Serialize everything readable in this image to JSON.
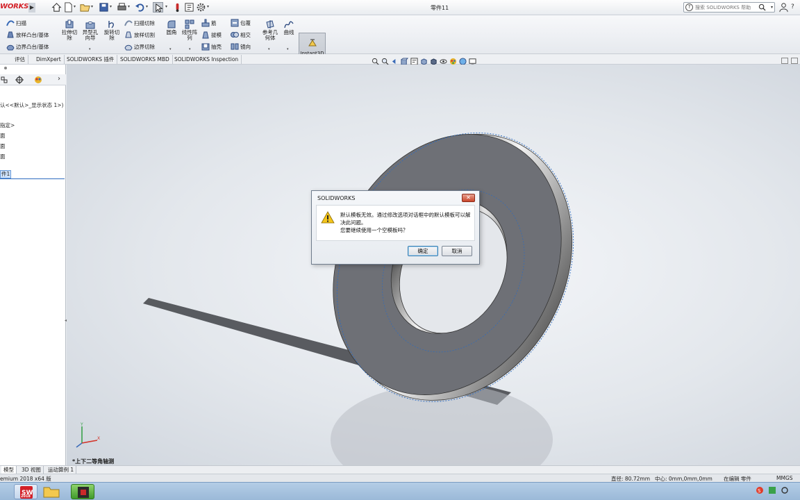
{
  "app": {
    "logo_text": "WORKS",
    "window_title": "零件11",
    "search_placeholder": "搜索 SOLIDWORKS 帮助"
  },
  "ribbon": {
    "sweep": "扫描",
    "loft_boss": "放样凸台/基体",
    "boundary_boss": "边界凸台/基体",
    "extrude_cut": "拉伸切除",
    "hole_wizard": "异型孔向导",
    "revolve_cut": "旋转切除",
    "swept_cut": "扫描切除",
    "lofted_cut": "放样切割",
    "boundary_cut": "边界切除",
    "fillet": "圆角",
    "linear_pattern": "线性阵列",
    "rib": "筋",
    "draft": "拔模",
    "shell": "抽壳",
    "wrap": "包覆",
    "intersect": "相交",
    "mirror": "镜向",
    "ref_geometry": "参考几何体",
    "curves": "曲线",
    "instant3d": "Instant3D"
  },
  "command_tabs": [
    "评估",
    "DimXpert",
    "SOLIDWORKS 插件",
    "SOLIDWORKS MBD",
    "SOLIDWORKS Inspection"
  ],
  "tree": {
    "config_line": "认<<默认>_显示状态 1>)",
    "items": [
      "指定>",
      "面",
      "面",
      "面"
    ],
    "selected": "件1"
  },
  "dialog": {
    "title": "SOLIDWORKS",
    "message_line1": "默认模板无效。通过修改选项对话框中的默认模板可以解决此问题。",
    "message_line2": "您要继续使用一个空模板吗？",
    "ok_label": "确定",
    "cancel_label": "取消"
  },
  "viewport": {
    "view_label": "*上下二等角轴测"
  },
  "bottom_tabs": [
    "模型",
    "3D 视图",
    "运动算例 1"
  ],
  "status": {
    "product": "emium 2018 x64 版",
    "diameter": "直径: 80.72mm",
    "center": "中心: 0mm,0mm,0mm",
    "editing": "在编辑 零件",
    "units": "MMGS"
  },
  "taskbar": {
    "sw_badge": "2018"
  },
  "colors": {
    "brand_red": "#d32027",
    "selection_blue": "#2d6bbf",
    "part_gray": "#6e7076"
  }
}
